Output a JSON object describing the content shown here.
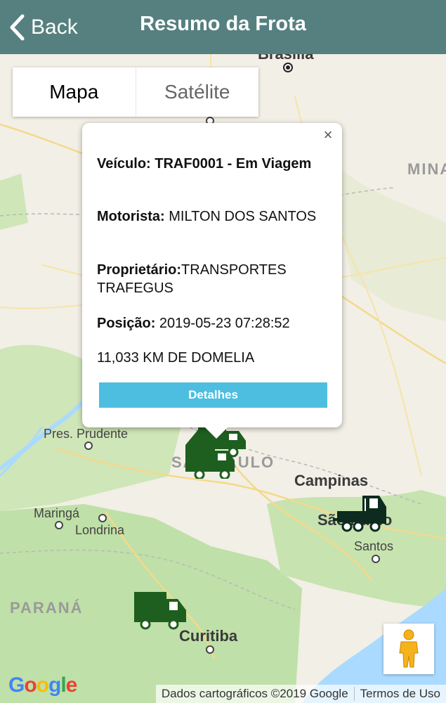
{
  "header": {
    "back_label": "Back",
    "title": "Resumo da Frota"
  },
  "map_type": {
    "map_label": "Mapa",
    "satellite_label": "Satélite"
  },
  "info_window": {
    "vehicle_label": "Veículo:",
    "vehicle_value": "TRAF0001 - Em Viagem",
    "driver_label": "Motorista:",
    "driver_value": "MILTON DOS SANTOS",
    "owner_label": "Proprietário:",
    "owner_value": "TRANSPORTES TRAFEGUS",
    "position_label": "Posição:",
    "position_value": "2019-05-23 07:28:52",
    "distance": "11,033 KM DE DOMELIA",
    "details_button": "Detalhes",
    "close": "×"
  },
  "map_labels": {
    "brasilia": "Brasília",
    "minas": "MINA",
    "pres_prudente": "Pres. Prudente",
    "sao_paulo_state": "SÃO PAULO",
    "campinas": "Campinas",
    "sao_paulo_city": "São Paulo",
    "santos": "Santos",
    "maringa": "Maringá",
    "londrina": "Londrina",
    "parana": "PARANÁ",
    "curitiba": "Curitiba"
  },
  "footer": {
    "google": "Google",
    "attribution": "Dados cartográficos ©2019 Google",
    "terms": "Termos de Uso"
  },
  "colors": {
    "header_bg": "#55807f",
    "button_bg": "#4dbedf",
    "truck_green": "#1e5e1e",
    "truck_dark": "#0d2b1e",
    "water": "#aadaff",
    "forest": "#bfe0a8"
  }
}
